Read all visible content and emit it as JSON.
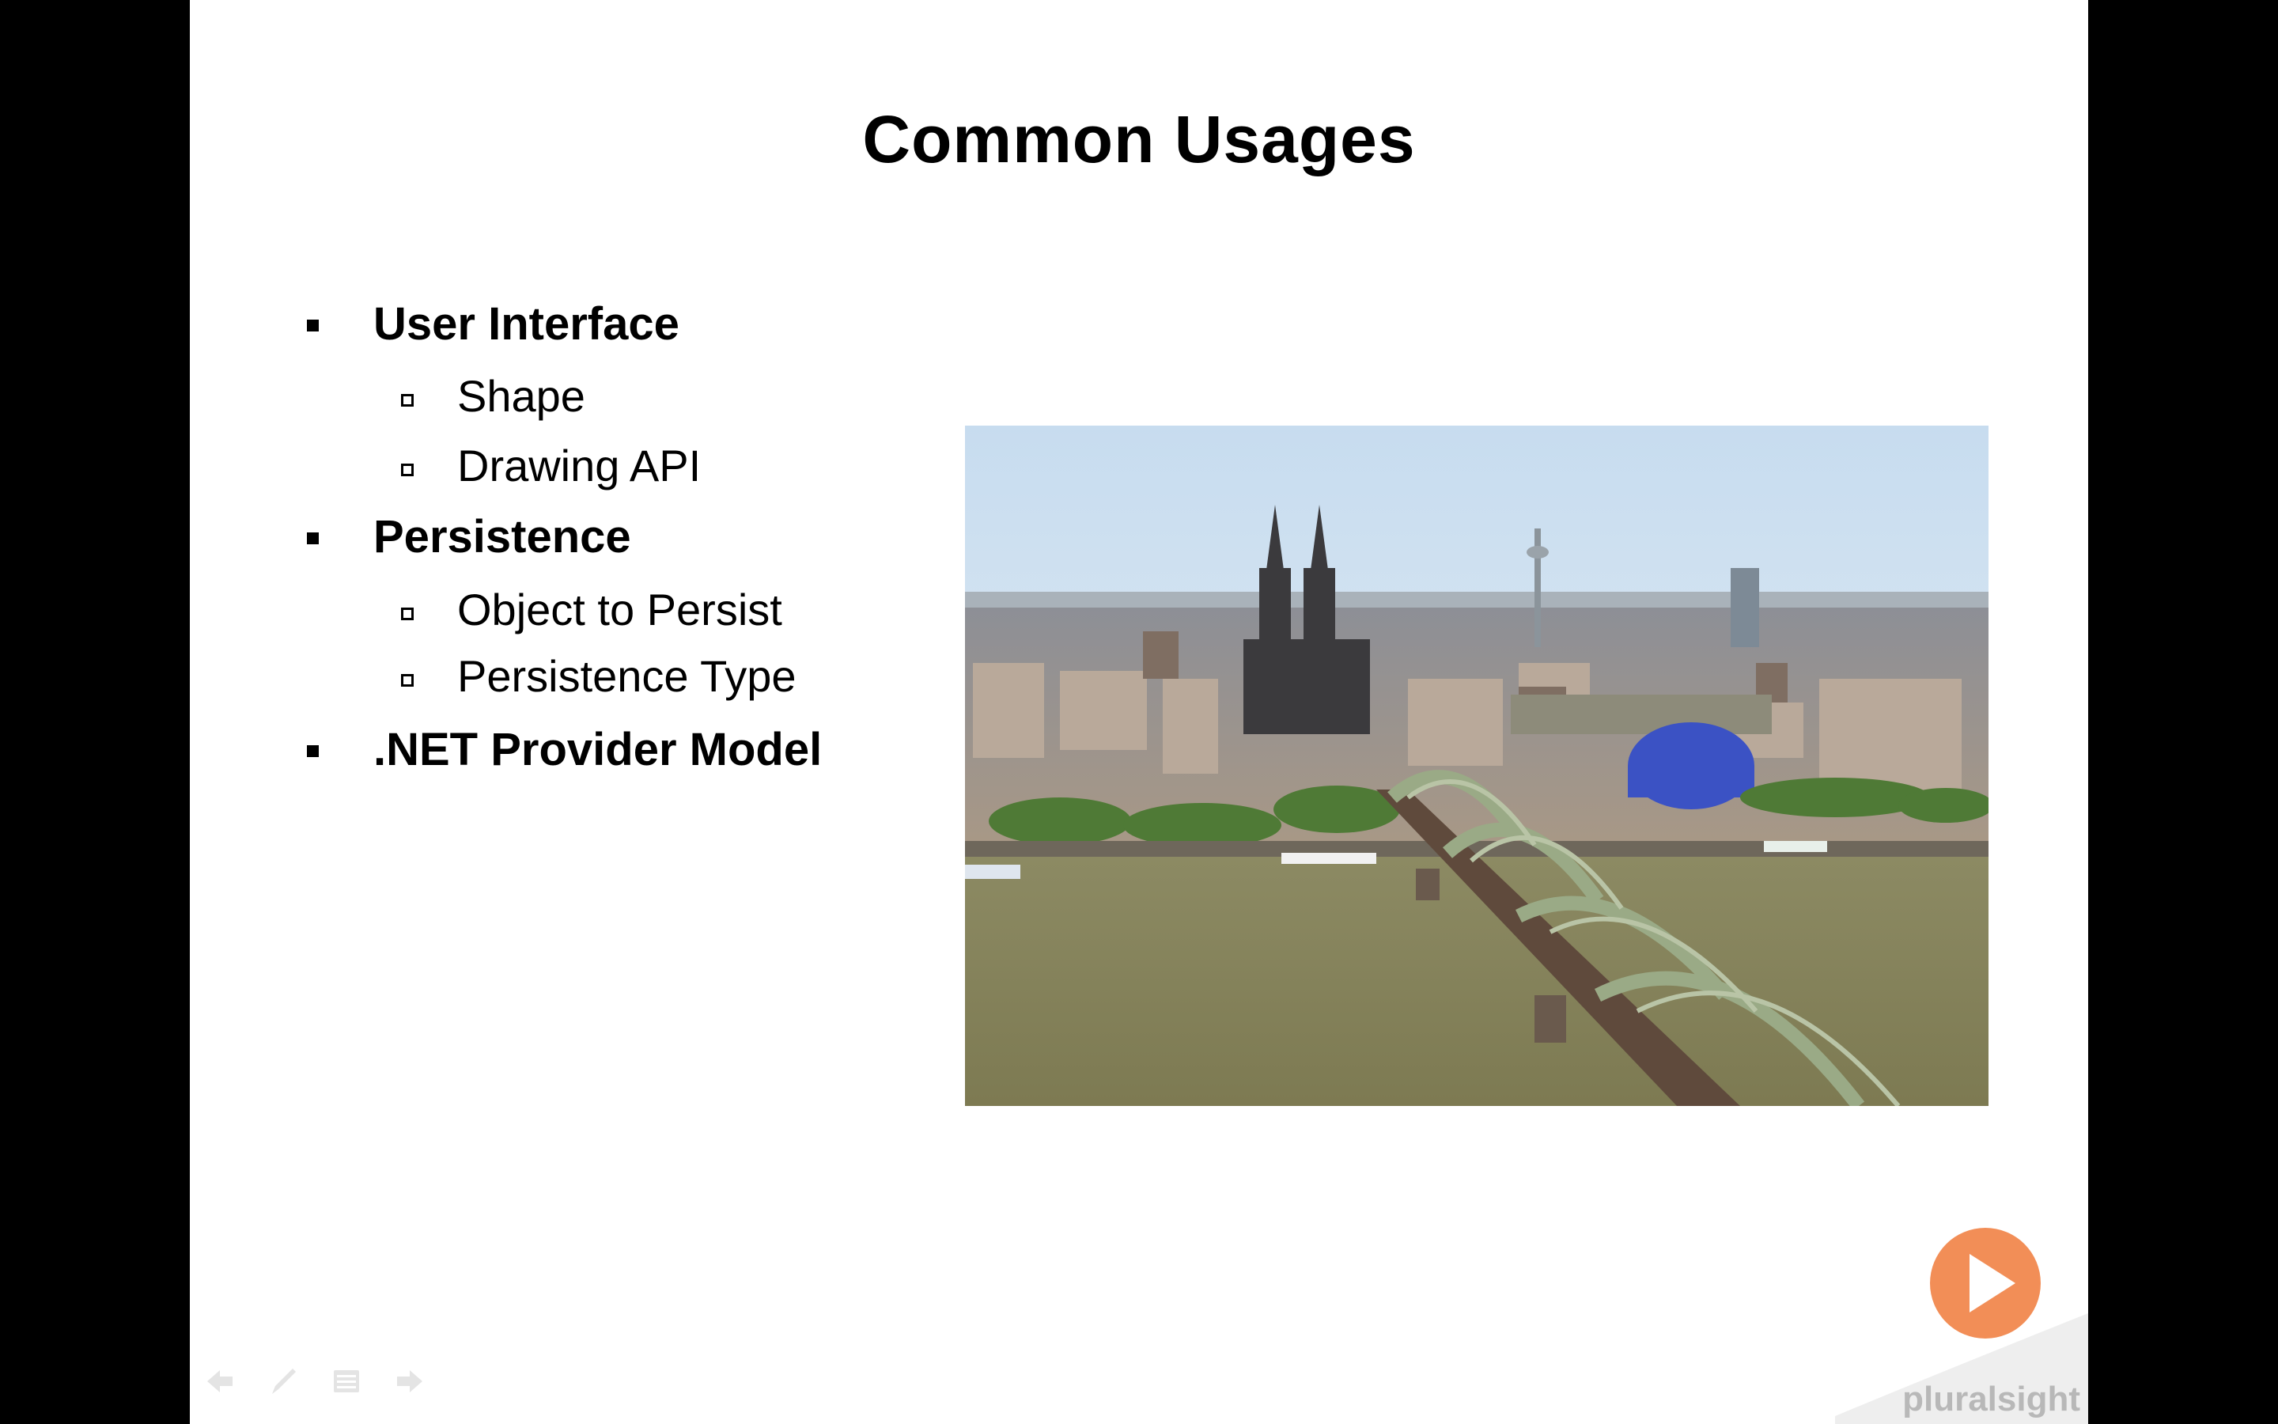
{
  "slide": {
    "title": "Common Usages",
    "bullets": [
      {
        "text": "User Interface",
        "level": 1
      },
      {
        "text": "Shape",
        "level": 2
      },
      {
        "text": "Drawing API",
        "level": 2
      },
      {
        "text": "Persistence",
        "level": 1
      },
      {
        "text": "Object to Persist",
        "level": 2
      },
      {
        "text": "Persistence Type",
        "level": 2
      },
      {
        "text": ".NET Provider Model",
        "level": 1
      }
    ],
    "image": {
      "subject": "cologne-cathedral-and-hohenzollern-bridge-photo"
    }
  },
  "branding": {
    "logo_text": "pluralsight",
    "accent_color": "#f07a3a"
  },
  "controls": {
    "icons": [
      "back-arrow-icon",
      "pen-icon",
      "menu-icon",
      "forward-arrow-icon"
    ]
  }
}
